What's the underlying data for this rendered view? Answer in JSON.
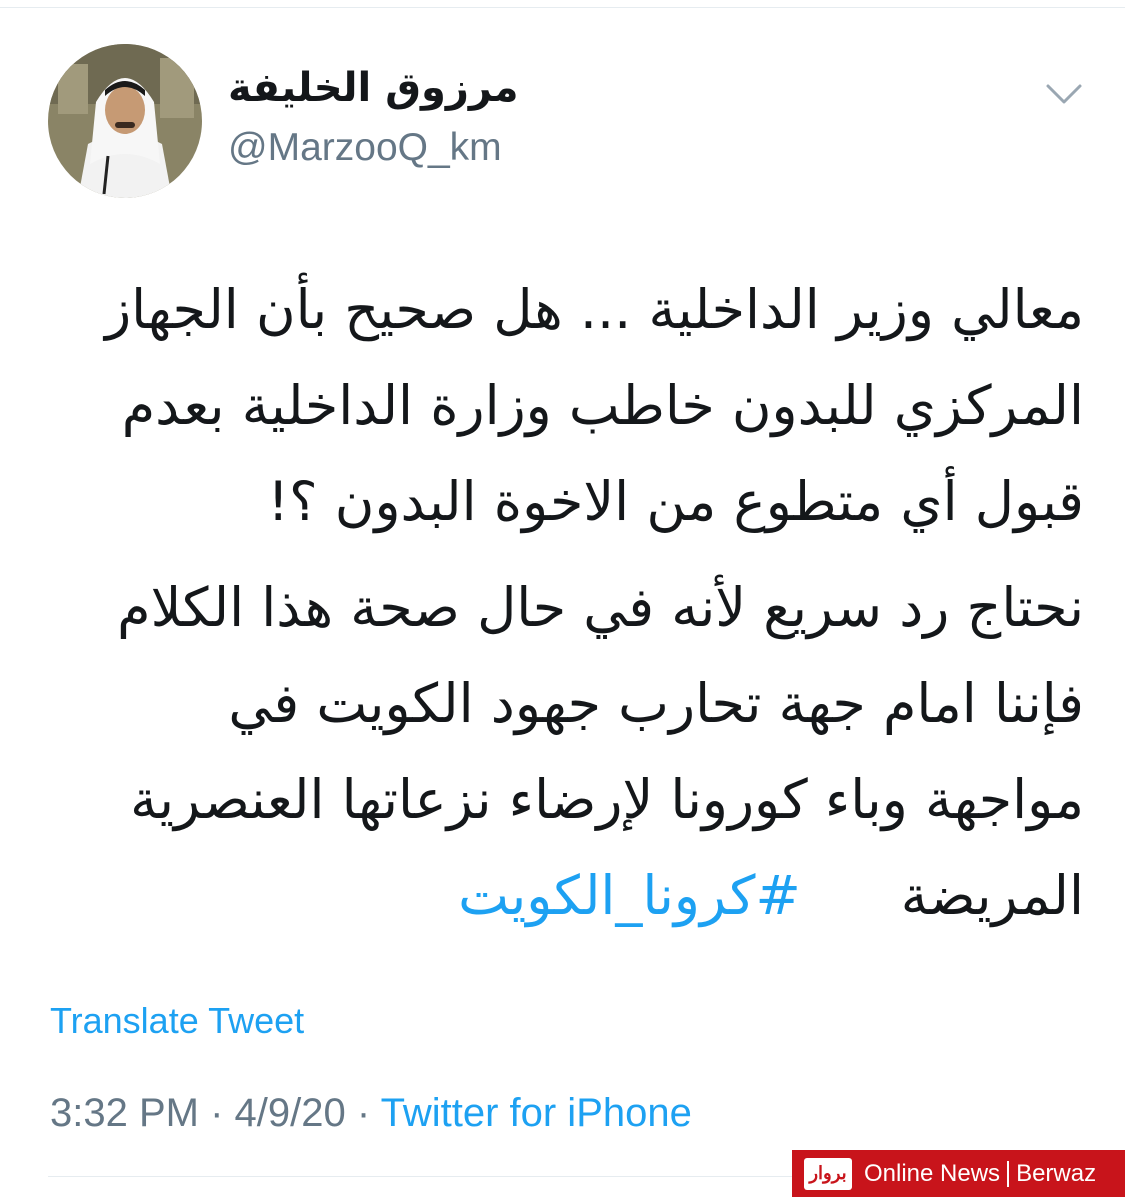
{
  "tweet": {
    "author": {
      "display_name": "مرزوق الخليفة",
      "handle": "@MarzooQ_km"
    },
    "menu_icon": "chevron-down-icon",
    "body_lines": [
      "معالي وزير الداخلية ... هل صحيح بأن الجهاز",
      "المركزي للبدون خاطب وزارة الداخلية بعدم",
      "قبول أي متطوع من الاخوة البدون ؟!",
      "نحتاج رد سريع لأنه في حال صحة هذا الكلام",
      "فإننا امام جهة تحارب جهود الكويت في",
      "مواجهة وباء كورونا لإرضاء نزعاتها العنصرية",
      "المريضة"
    ],
    "hashtag": "#كرونا_الكويت",
    "translate_label": "Translate Tweet",
    "time": "3:32 PM",
    "date": "4/9/20",
    "separator": "·",
    "source": "Twitter for iPhone"
  },
  "watermark": {
    "logo_text": "بروار",
    "left_text": "Online News",
    "right_text": "Berwaz"
  },
  "colors": {
    "text": "#14171a",
    "secondary": "#657786",
    "link": "#1da1f2",
    "watermark_bg": "#c8141b"
  }
}
